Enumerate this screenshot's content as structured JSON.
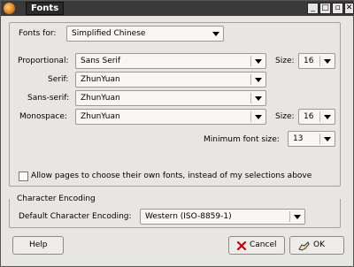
{
  "window": {
    "title": "Fonts"
  },
  "titlebar_buttons": {
    "minimize": "_",
    "restore": "□",
    "maximize": "▫",
    "close": "✕"
  },
  "fonts_for": {
    "label": "Fonts for:",
    "value": "Simplified Chinese"
  },
  "proportional": {
    "label": "Proportional:",
    "value": "Sans Serif",
    "size_label": "Size:",
    "size_value": "16"
  },
  "serif": {
    "label": "Serif:",
    "value": "ZhunYuan"
  },
  "sans_serif": {
    "label": "Sans-serif:",
    "value": "ZhunYuan"
  },
  "monospace": {
    "label": "Monospace:",
    "value": "ZhunYuan",
    "size_label": "Size:",
    "size_value": "16"
  },
  "minimum_font_size": {
    "label": "Minimum font size:",
    "value": "13"
  },
  "allow_pages": {
    "label": "Allow pages to choose their own fonts, instead of my selections above",
    "checked": false
  },
  "character_encoding": {
    "group_label": "Character Encoding",
    "label": "Default Character Encoding:",
    "value": "Western (ISO-8859-1)"
  },
  "buttons": {
    "help": "Help",
    "cancel": "Cancel",
    "ok": "OK"
  },
  "colors": {
    "titlebar": "#3a3a3a",
    "window_bg": "#e8e6e2"
  }
}
